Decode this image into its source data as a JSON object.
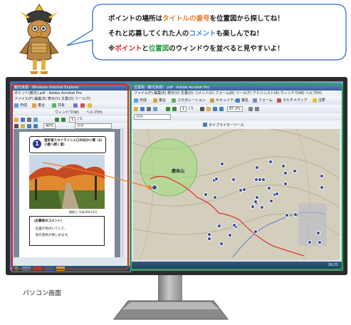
{
  "bubble": {
    "line1": [
      "ポイントの場所は",
      "タイトルの番号",
      "を位置図から探してね！"
    ],
    "line2": [
      "それと応募してくれた人の",
      "コメント",
      "も楽しんでね！"
    ],
    "line3": [
      "※",
      "ポイント",
      "と",
      "位置図",
      "のウィンドウを並べると見やすいよ！"
    ]
  },
  "left_window": {
    "title": "観光資源 - Windows Internet Explorer",
    "subtitle": "ポイント(観光).pdf - Adobe Acrobat Pro",
    "menu": "ファイル(F) 編集(E) 表示(V) 文書(D) ツール(T)",
    "toolbar1_items": [
      "作成",
      "複合",
      "共有"
    ],
    "toolbar2_items": [
      "ウィンドウ(W)",
      "ヘルプ(H)"
    ],
    "page_field": "1",
    "page_total": "/ 1",
    "zoom": "40%",
    "search_placeholder": "検索",
    "doc": {
      "number": "1",
      "heading": "遊歩道スカイライン入口の向かい側（山小屋へ続く道）",
      "photo_caption": "撮影日 平成28年10月",
      "comment_title": "（応募者のコメント）",
      "comment_line1": "紅葉が色付いていて、",
      "comment_line2": "秋の景色が楽しめます。"
    },
    "taskbar_items": [
      "スタート"
    ]
  },
  "right_window": {
    "title": "位置図（観光資源）.pdf - Adobe Acrobat Pro",
    "menu": "ファイル(F) 編集(E) 表示(V) 文書(D) コメント(C) フォーム(R) ツール(T) アドバンスト(A) ウィンドウ(W) ヘルプ(H)",
    "toolbar1_items": [
      "作成",
      "複合",
      "コラボレーション",
      "セキュリティ",
      "署名",
      "フォーム",
      "マルチメディア",
      "注釈"
    ],
    "page_field": "1",
    "page_total": "/ 1",
    "zoom": "87.2%",
    "search_placeholder": "検索",
    "tab_label": "タイプライターツール",
    "map": {
      "mountain_label": "鹿本山",
      "point_count_shown": 42
    },
    "clock": "16:21"
  },
  "monitor_label": "パソコン画面",
  "colors": {
    "red_frame": "#e02020",
    "green_frame": "#18a848",
    "bubble_border": "#2a6fd0",
    "circle_fill": "#9be07a",
    "route_color": "#e03838"
  }
}
